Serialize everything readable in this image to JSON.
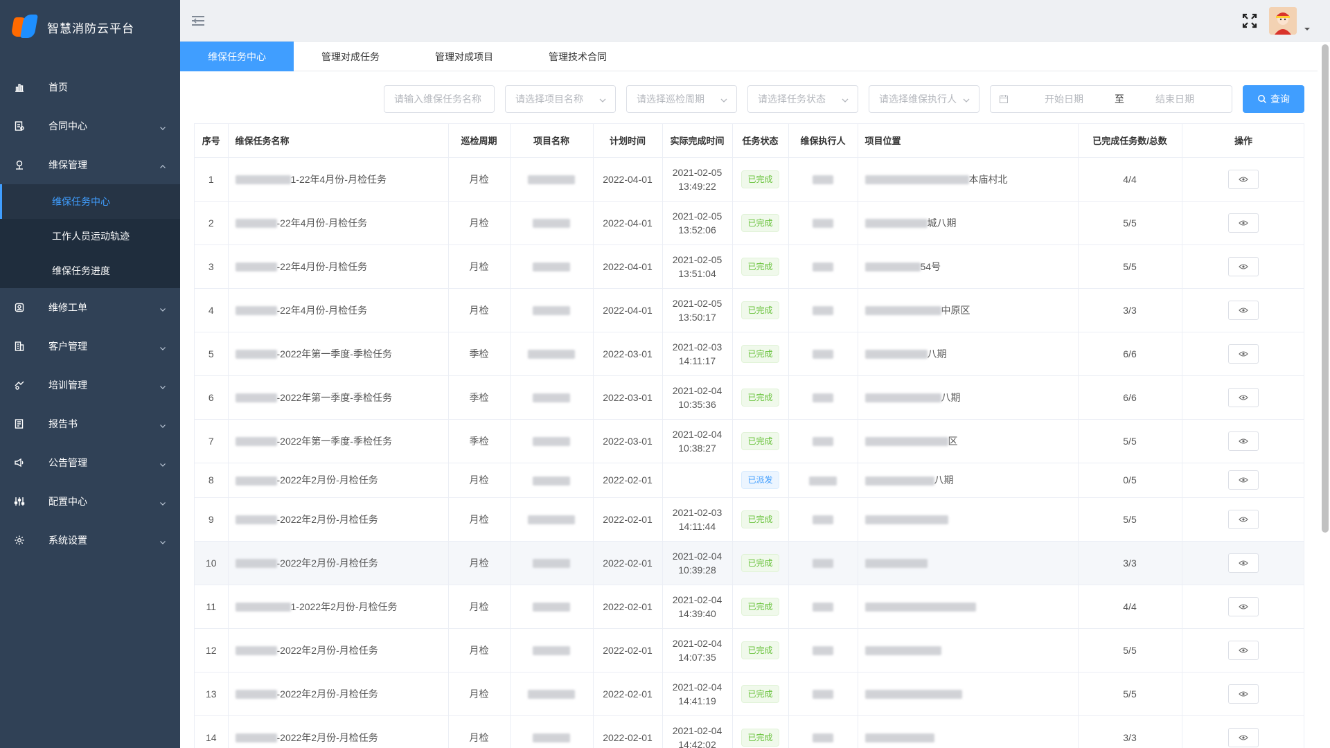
{
  "app": {
    "title": "智慧消防云平台"
  },
  "sidebar": {
    "items": [
      {
        "label": "首页",
        "icon": "bar-chart-icon",
        "expandable": false
      },
      {
        "label": "合同中心",
        "icon": "contract-icon",
        "expandable": true
      },
      {
        "label": "维保管理",
        "icon": "maintenance-icon",
        "expandable": true,
        "open": true,
        "children": [
          {
            "label": "维保任务中心",
            "active": true
          },
          {
            "label": "工作人员运动轨迹"
          },
          {
            "label": "维保任务进度"
          }
        ]
      },
      {
        "label": "维修工单",
        "icon": "repair-icon",
        "expandable": true
      },
      {
        "label": "客户管理",
        "icon": "building-icon",
        "expandable": true
      },
      {
        "label": "培训管理",
        "icon": "training-icon",
        "expandable": true
      },
      {
        "label": "报告书",
        "icon": "report-icon",
        "expandable": true
      },
      {
        "label": "公告管理",
        "icon": "megaphone-icon",
        "expandable": true
      },
      {
        "label": "配置中心",
        "icon": "sliders-icon",
        "expandable": true
      },
      {
        "label": "系统设置",
        "icon": "gear-icon",
        "expandable": true
      }
    ]
  },
  "tabs": [
    {
      "label": "维保任务中心",
      "active": true
    },
    {
      "label": "管理对成任务"
    },
    {
      "label": "管理对成项目"
    },
    {
      "label": "管理技术合同"
    }
  ],
  "filters": {
    "task_name_placeholder": "请输入维保任务名称",
    "project_placeholder": "请选择项目名称",
    "cycle_placeholder": "请选择巡检周期",
    "status_placeholder": "请选择任务状态",
    "executor_placeholder": "请选择维保执行人",
    "start_date_placeholder": "开始日期",
    "date_separator": "至",
    "end_date_placeholder": "结束日期",
    "query_label": "查询"
  },
  "table": {
    "columns": [
      "序号",
      "维保任务名称",
      "巡检周期",
      "项目名称",
      "计划时间",
      "实际完成时间",
      "任务状态",
      "维保执行人",
      "项目位置",
      "已完成任务数/总数",
      "操作"
    ],
    "rows": [
      {
        "no": "1",
        "name": "1-22年4月份-月检任务",
        "cycle": "月检",
        "plan": "2022-04-01",
        "done_date": "2021-02-05",
        "done_time": "13:49:22",
        "status": "已完成",
        "status_type": "done",
        "loc": "本庙村北",
        "progress": "4/4"
      },
      {
        "no": "2",
        "name": "-22年4月份-月检任务",
        "cycle": "月检",
        "plan": "2022-04-01",
        "done_date": "2021-02-05",
        "done_time": "13:52:06",
        "status": "已完成",
        "status_type": "done",
        "loc": "城八期",
        "progress": "5/5"
      },
      {
        "no": "3",
        "name": "-22年4月份-月检任务",
        "cycle": "月检",
        "plan": "2022-04-01",
        "done_date": "2021-02-05",
        "done_time": "13:51:04",
        "status": "已完成",
        "status_type": "done",
        "loc": "54号",
        "progress": "5/5"
      },
      {
        "no": "4",
        "name": "-22年4月份-月检任务",
        "cycle": "月检",
        "plan": "2022-04-01",
        "done_date": "2021-02-05",
        "done_time": "13:50:17",
        "status": "已完成",
        "status_type": "done",
        "loc": "中原区",
        "progress": "3/3"
      },
      {
        "no": "5",
        "name": "-2022年第一季度-季检任务",
        "cycle": "季检",
        "plan": "2022-03-01",
        "done_date": "2021-02-03",
        "done_time": "14:11:17",
        "status": "已完成",
        "status_type": "done",
        "loc": "八期",
        "progress": "6/6"
      },
      {
        "no": "6",
        "name": "-2022年第一季度-季检任务",
        "cycle": "季检",
        "plan": "2022-03-01",
        "done_date": "2021-02-04",
        "done_time": "10:35:36",
        "status": "已完成",
        "status_type": "done",
        "loc": "八期",
        "progress": "6/6"
      },
      {
        "no": "7",
        "name": "-2022年第一季度-季检任务",
        "cycle": "季检",
        "plan": "2022-03-01",
        "done_date": "2021-02-04",
        "done_time": "10:38:27",
        "status": "已完成",
        "status_type": "done",
        "loc": "区",
        "progress": "5/5"
      },
      {
        "no": "8",
        "name": "-2022年2月份-月检任务",
        "cycle": "月检",
        "plan": "2022-02-01",
        "done_date": "",
        "done_time": "",
        "status": "已派发",
        "status_type": "sent",
        "loc": "八期",
        "progress": "0/5"
      },
      {
        "no": "9",
        "name": "-2022年2月份-月检任务",
        "cycle": "月检",
        "plan": "2022-02-01",
        "done_date": "2021-02-03",
        "done_time": "14:11:44",
        "status": "已完成",
        "status_type": "done",
        "loc": "",
        "progress": "5/5"
      },
      {
        "no": "10",
        "name": "-2022年2月份-月检任务",
        "cycle": "月检",
        "plan": "2022-02-01",
        "done_date": "2021-02-04",
        "done_time": "10:39:28",
        "status": "已完成",
        "status_type": "done",
        "loc": "",
        "progress": "3/3"
      },
      {
        "no": "11",
        "name": "1-2022年2月份-月检任务",
        "cycle": "月检",
        "plan": "2022-02-01",
        "done_date": "2021-02-04",
        "done_time": "14:39:40",
        "status": "已完成",
        "status_type": "done",
        "loc": "",
        "progress": "4/4"
      },
      {
        "no": "12",
        "name": "-2022年2月份-月检任务",
        "cycle": "月检",
        "plan": "2022-02-01",
        "done_date": "2021-02-04",
        "done_time": "14:07:35",
        "status": "已完成",
        "status_type": "done",
        "loc": "",
        "progress": "5/5"
      },
      {
        "no": "13",
        "name": "-2022年2月份-月检任务",
        "cycle": "月检",
        "plan": "2022-02-01",
        "done_date": "2021-02-04",
        "done_time": "14:41:19",
        "status": "已完成",
        "status_type": "done",
        "loc": "",
        "progress": "5/5"
      },
      {
        "no": "14",
        "name": "-2022年2月份-月检任务",
        "cycle": "月检",
        "plan": "2022-02-01",
        "done_date": "2021-02-04",
        "done_time": "14:42:02",
        "status": "已完成",
        "status_type": "done",
        "loc": "",
        "progress": "3/3"
      }
    ]
  },
  "colors": {
    "accent": "#409eff",
    "sidebar_bg": "#304156",
    "submenu_bg": "#1f2d3d",
    "done": "#67c23a"
  }
}
